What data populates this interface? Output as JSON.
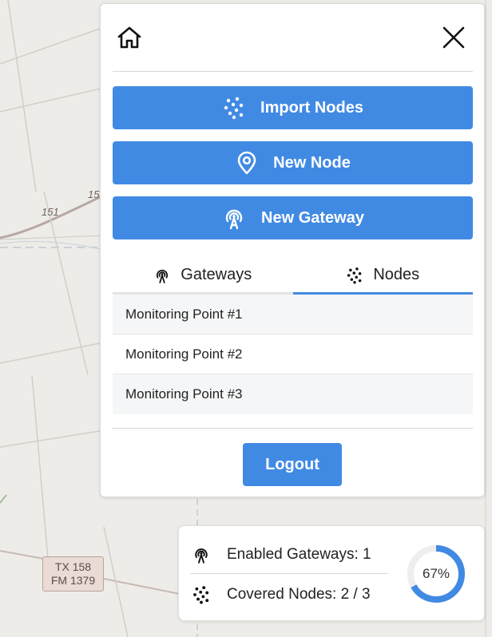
{
  "map": {
    "road_labels": [
      "151",
      "15"
    ],
    "shield_lines": [
      "TX 158",
      "FM 1379"
    ]
  },
  "panel": {
    "home_icon": "home-icon",
    "close_icon": "close-icon",
    "buttons": {
      "import_nodes": "Import Nodes",
      "new_node": "New Node",
      "new_gateway": "New Gateway"
    },
    "tabs": [
      {
        "label": "Gateways",
        "icon": "gateway-icon",
        "active": false
      },
      {
        "label": "Nodes",
        "icon": "nodes-icon",
        "active": true
      }
    ],
    "nodes": [
      {
        "label": "Monitoring Point #1"
      },
      {
        "label": "Monitoring Point #2"
      },
      {
        "label": "Monitoring Point #3"
      }
    ],
    "logout_label": "Logout"
  },
  "stats": {
    "enabled_gateways": "Enabled Gateways: 1",
    "covered_nodes": "Covered Nodes: 2 / 3",
    "coverage_label": "67%",
    "coverage_fraction": 0.67
  },
  "colors": {
    "accent": "#418ae3",
    "map_background": "#eeece8"
  }
}
